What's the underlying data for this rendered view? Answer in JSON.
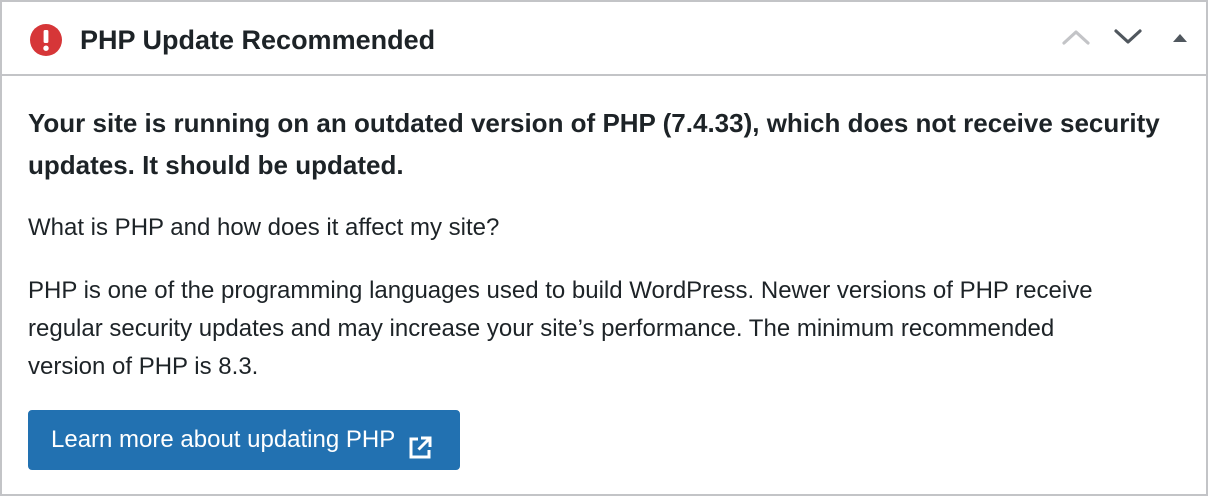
{
  "header": {
    "title": "PHP Update Recommended",
    "status_icon": "error-exclamation-icon",
    "status_color": "#d63638",
    "actions": {
      "move_up_label": "Move up",
      "move_down_label": "Move down",
      "toggle_label": "Toggle panel"
    }
  },
  "body": {
    "intro": "Your site is running on an outdated version of PHP (7.4.33), which does not receive security updates. It should be updated.",
    "question": "What is PHP and how does it affect my site?",
    "description": "PHP is one of the programming languages used to build WordPress. Newer versions of PHP receive regular security updates and may increase your site’s performance. The minimum recommended version of PHP is 8.3.",
    "button": {
      "label": "Learn more about updating PHP",
      "icon": "external-link-icon",
      "color": "#2271b1"
    }
  }
}
